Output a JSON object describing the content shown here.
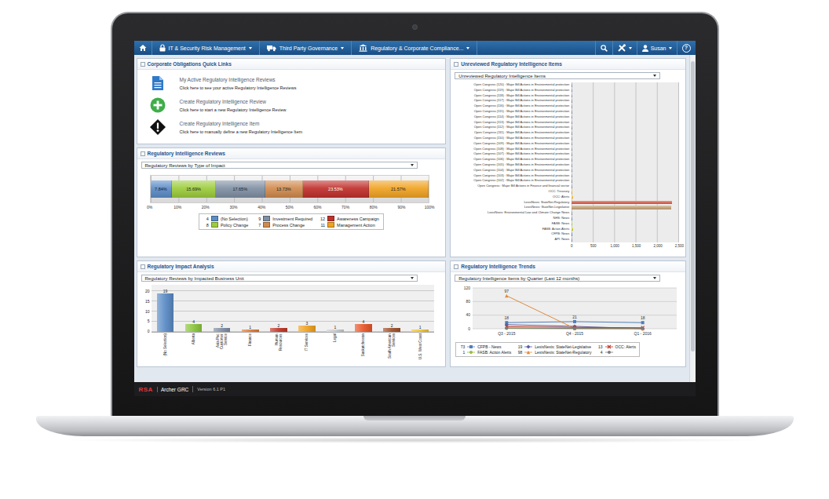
{
  "nav": {
    "items": [
      {
        "label": "IT & Security Risk Management",
        "kind": "lock"
      },
      {
        "label": "Third Party Governance",
        "kind": "truck"
      },
      {
        "label": "Regulatory & Corporate Compliance...",
        "kind": "building"
      }
    ],
    "user": "Susan",
    "help": "?"
  },
  "quick_links": {
    "title": "Corporate Obligations Quick Links",
    "links": [
      {
        "kind": "document",
        "title": "My Active Regulatory Intelligence Reviews",
        "description": "Click here to see your active Regulatory Intelligence Reviews"
      },
      {
        "kind": "add",
        "title": "Create Regulatory Intelligence Review",
        "description": "Click here to start a new Regulatory Intelligence Review"
      },
      {
        "kind": "alert",
        "title": "Create Regulatory Intelligence Item",
        "description": "Click here to manually define a new Regulatory Intelligence Item"
      }
    ]
  },
  "reviews": {
    "title": "Regulatory Intelligence Reviews",
    "dropdown": "Regulatory Reviews by Type of Impact",
    "segments": [
      {
        "label": "(No Selection)",
        "count": "4",
        "value": 4,
        "percent": "7.84%",
        "color": "#5b8cc6"
      },
      {
        "label": "Policy Change",
        "count": "8",
        "value": 8,
        "percent": "15.69%",
        "color": "#9ccc3c"
      },
      {
        "label": "Investment Required",
        "count": "9",
        "value": 9,
        "percent": "17.65%",
        "color": "#7f8fa3"
      },
      {
        "label": "Process Change",
        "count": "7",
        "value": 7,
        "percent": "13.73%",
        "color": "#d08a4e"
      },
      {
        "label": "Awareness Campaign",
        "count": "12",
        "value": 12,
        "percent": "23.53%",
        "color": "#c0302c"
      },
      {
        "label": "Management Action",
        "count": "11",
        "value": 11,
        "percent": "21.57%",
        "color": "#f0a323"
      }
    ],
    "ticks": [
      "0%",
      "10%",
      "20%",
      "30%",
      "40%",
      "50%",
      "60%",
      "70%",
      "80%",
      "90%",
      "100%"
    ]
  },
  "impact": {
    "title": "Regulatory Impact Analysis",
    "dropdown": "Regulatory Reviews by Impacted Business Unit",
    "y_ticks": [
      "0",
      "5",
      "10",
      "15",
      "20"
    ],
    "bars": [
      {
        "label": "(No Selection)",
        "value": 19,
        "value_label": "19",
        "color": "#5b8cc6"
      },
      {
        "label": "Alberta",
        "value": 4,
        "value_label": "4",
        "color": "#8cc63f"
      },
      {
        "label": "Asia Pac Customer Service",
        "value": 2,
        "value_label": "2",
        "color": "#7f8fa3"
      },
      {
        "label": "Finance",
        "value": 1,
        "value_label": "1",
        "color": "#e07b39"
      },
      {
        "label": "Human Resources",
        "value": 2,
        "value_label": "2",
        "color": "#c0392b"
      },
      {
        "label": "IT Services",
        "value": 3,
        "value_label": "3",
        "color": "#f0a323"
      },
      {
        "label": "Legal",
        "value": 1,
        "value_label": "1",
        "color": "#c9ccd0"
      },
      {
        "label": "Saskatchewan",
        "value": 4,
        "value_label": "4",
        "color": "#e8572a"
      },
      {
        "label": "South American Services",
        "value": 2,
        "value_label": "2",
        "color": "#a0522d"
      },
      {
        "label": "U.S. West Coast",
        "value": 1,
        "value_label": "1",
        "color": "#f2c335"
      }
    ]
  },
  "unreviewed": {
    "title": "Unreviewed Regulatory Intelligence Items",
    "dropdown": "Unreviewed Regulatory Intelligence Items",
    "x_ticks": [
      "0",
      "500",
      "1,000",
      "1,500",
      "2,000",
      "2,500"
    ],
    "rows": [
      {
        "label": "Open Congress (120) : Major Bill Actions in Environmental protection",
        "value": 1,
        "color": "#7f8fa3"
      },
      {
        "label": "Open Congress (119) : Major Bill Actions in Environmental protection",
        "value": 1,
        "color": "#7f8fa3"
      },
      {
        "label": "Open Congress (118) : Major Bill Actions in Environmental protection",
        "value": 1,
        "color": "#7f8fa3"
      },
      {
        "label": "Open Congress (117) : Major Bill Actions in Environmental protection",
        "value": 1,
        "color": "#7f8fa3"
      },
      {
        "label": "Open Congress (116) : Major Bill Actions in Environmental protection",
        "value": 1,
        "color": "#7f8fa3"
      },
      {
        "label": "Open Congress (115) : Major Bill Actions in Environmental protection",
        "value": 1,
        "color": "#7f8fa3"
      },
      {
        "label": "Open Congress (114) : Major Bill Actions in Environmental protection",
        "value": 1,
        "color": "#7f8fa3"
      },
      {
        "label": "Open Congress (113) : Major Bill Actions in Environmental protection",
        "value": 1,
        "color": "#7f8fa3"
      },
      {
        "label": "Open Congress (112) : Major Bill Actions in Environmental protection",
        "value": 1,
        "color": "#7f8fa3"
      },
      {
        "label": "Open Congress (111) : Major Bill Actions in Environmental protection",
        "value": 1,
        "color": "#7f8fa3"
      },
      {
        "label": "Open Congress (110) : Major Bill Actions in Environmental protection",
        "value": 1,
        "color": "#7f8fa3"
      },
      {
        "label": "Open Congress (109) : Major Bill Actions in Environmental protection",
        "value": 1,
        "color": "#7f8fa3"
      },
      {
        "label": "Open Congress (108) : Major Bill Actions in Environmental protection",
        "value": 1,
        "color": "#7f8fa3"
      },
      {
        "label": "Open Congress (107) : Major Bill Actions in Environmental protection",
        "value": 1,
        "color": "#7f8fa3"
      },
      {
        "label": "Open Congress (106) : Major Bill Actions in Environmental protection",
        "value": 1,
        "color": "#7f8fa3"
      },
      {
        "label": "Open Congress (105) : Major Bill Actions in Environmental protection",
        "value": 1,
        "color": "#7f8fa3"
      },
      {
        "label": "Open Congress (104) : Major Bill Actions in Environmental protection",
        "value": 1,
        "color": "#7f8fa3"
      },
      {
        "label": "Open Congress (103) : Major Bill Actions in Environmental protection",
        "value": 1,
        "color": "#7f8fa3"
      },
      {
        "label": "Open Congress (102) : Major Bill Actions in Environmental protection",
        "value": 1,
        "color": "#7f8fa3"
      },
      {
        "label": "Open Congress : Major Bill Actions in Finance and financial sector",
        "value": 1,
        "color": "#7f8fa3"
      },
      {
        "label": "OCC: Treasury",
        "value": 6,
        "color": "#f0a323"
      },
      {
        "label": "OCC: Alerts",
        "value": 40,
        "color": "#f2c335"
      },
      {
        "label": "LexisNexis: StateNet-Regulatory",
        "value": 2340,
        "color": "#d9614c"
      },
      {
        "label": "LexisNexis: StateNet-Legislative",
        "value": 2330,
        "color": "#c4a27a"
      },
      {
        "label": "LexisNexis: Environmental Law and Climate Change News",
        "value": 8,
        "color": "#8a8a8a"
      },
      {
        "label": "NHS: News",
        "value": 3,
        "color": "#5b8cc6"
      },
      {
        "label": "FASB: News",
        "value": 5,
        "color": "#9ccc3c"
      },
      {
        "label": "FASB: Action Alerts",
        "value": 30,
        "color": "#c8d13a"
      },
      {
        "label": "CFPB: News",
        "value": 10,
        "color": "#4f7fb8"
      },
      {
        "label": "API: News",
        "value": 4,
        "color": "#7f8fa3"
      }
    ]
  },
  "trends": {
    "title": "Regulatory Intelligence Trends",
    "dropdown": "Regulatory Intelligence Items by Quarter (Last 12 months)",
    "y_ticks": [
      "0",
      "40",
      "80",
      "120"
    ],
    "x_labels": [
      "Q3 - 2015",
      "Q4 - 2015",
      "Q1 - 2016"
    ],
    "series": [
      {
        "name": "CFPB - News",
        "total": "73",
        "marker": "square",
        "color": "#4f7fb8",
        "values": [
          18,
          21,
          18
        ],
        "labels": [
          {
            "at": 0,
            "text": "18"
          },
          {
            "at": 1,
            "text": "21"
          },
          {
            "at": 2,
            "text": "18"
          }
        ]
      },
      {
        "name": "FASB: Action Alerts",
        "total": "1",
        "marker": "circle",
        "color": "#9bbb3b",
        "values": [
          1,
          0,
          0
        ],
        "labels": []
      },
      {
        "name": "LexisNexis: StateNet-Legislative",
        "total": "19",
        "marker": "diamond",
        "color": "#5b5ea6",
        "values": [
          12,
          7,
          0
        ],
        "labels": []
      },
      {
        "name": "LexisNexis: StateNet-Regulatory",
        "total": "98",
        "marker": "triangle",
        "color": "#e08a3c",
        "values": [
          97,
          1,
          0
        ],
        "labels": [
          {
            "at": 0,
            "text": "97"
          }
        ]
      },
      {
        "name": "OCC: Alerts",
        "total": "13",
        "marker": "cross",
        "color": "#c0392b",
        "values": [
          6,
          4,
          3
        ],
        "labels": []
      },
      {
        "name": "",
        "total": "4",
        "marker": "circle",
        "color": "#7a7a7a",
        "values": [
          2,
          1,
          1
        ],
        "labels": []
      }
    ]
  },
  "footer": {
    "brand": "RSA",
    "product": "Archer GRC",
    "version": "Version 6.1 P1"
  }
}
